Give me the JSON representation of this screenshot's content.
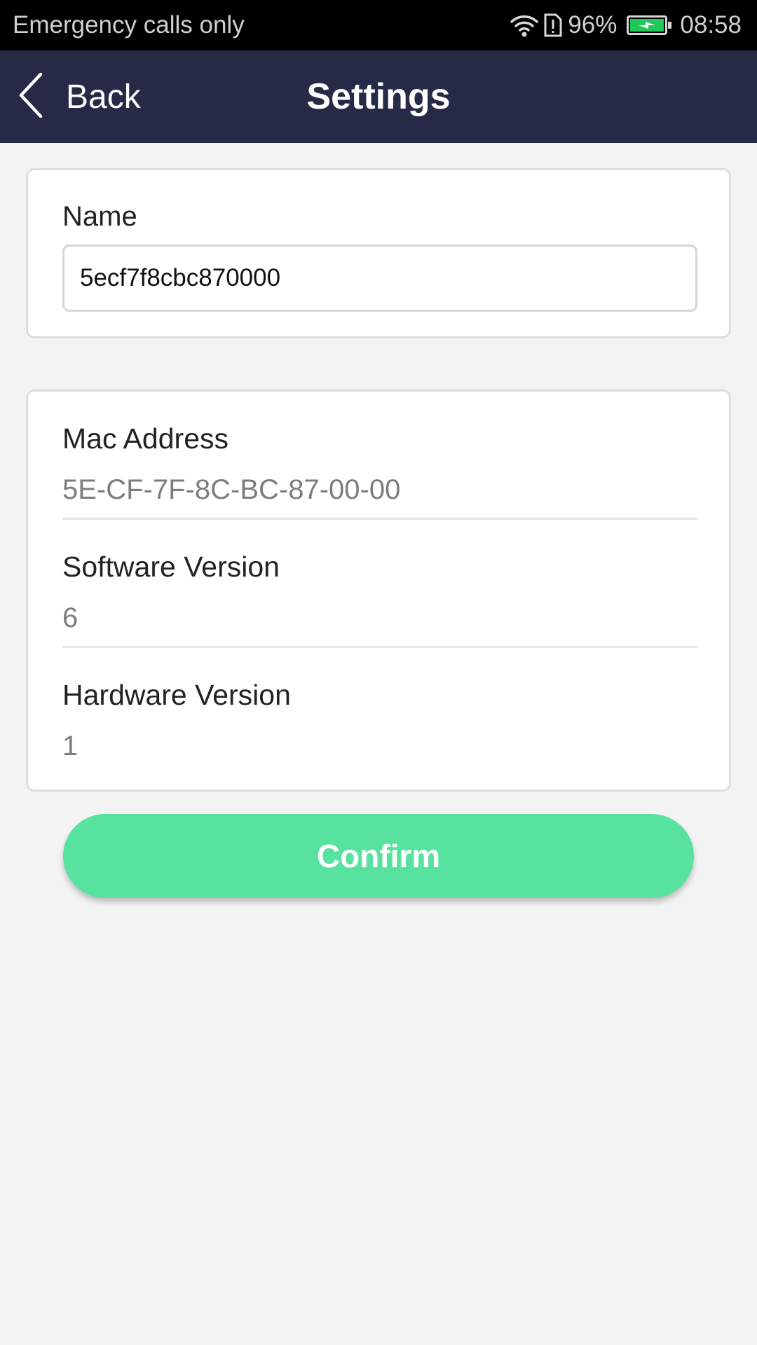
{
  "status_bar": {
    "carrier_text": "Emergency calls only",
    "battery_percent": "96%",
    "time": "08:58",
    "icons": [
      "wifi-icon",
      "sim-alert-icon",
      "battery-icon"
    ],
    "battery_color": "#1fc95a"
  },
  "header": {
    "back_label": "Back",
    "back_icon": "chevron-left-icon",
    "title": "Settings",
    "background": "#262a47"
  },
  "name_card": {
    "label": "Name",
    "value": "5ecf7f8cbc870000"
  },
  "info_card": {
    "rows": [
      {
        "label": "Mac Address",
        "value": "5E-CF-7F-8C-BC-87-00-00"
      },
      {
        "label": "Software Version",
        "value": "6"
      },
      {
        "label": "Hardware Version",
        "value": "1"
      }
    ]
  },
  "confirm": {
    "label": "Confirm",
    "color": "#57e29f"
  }
}
